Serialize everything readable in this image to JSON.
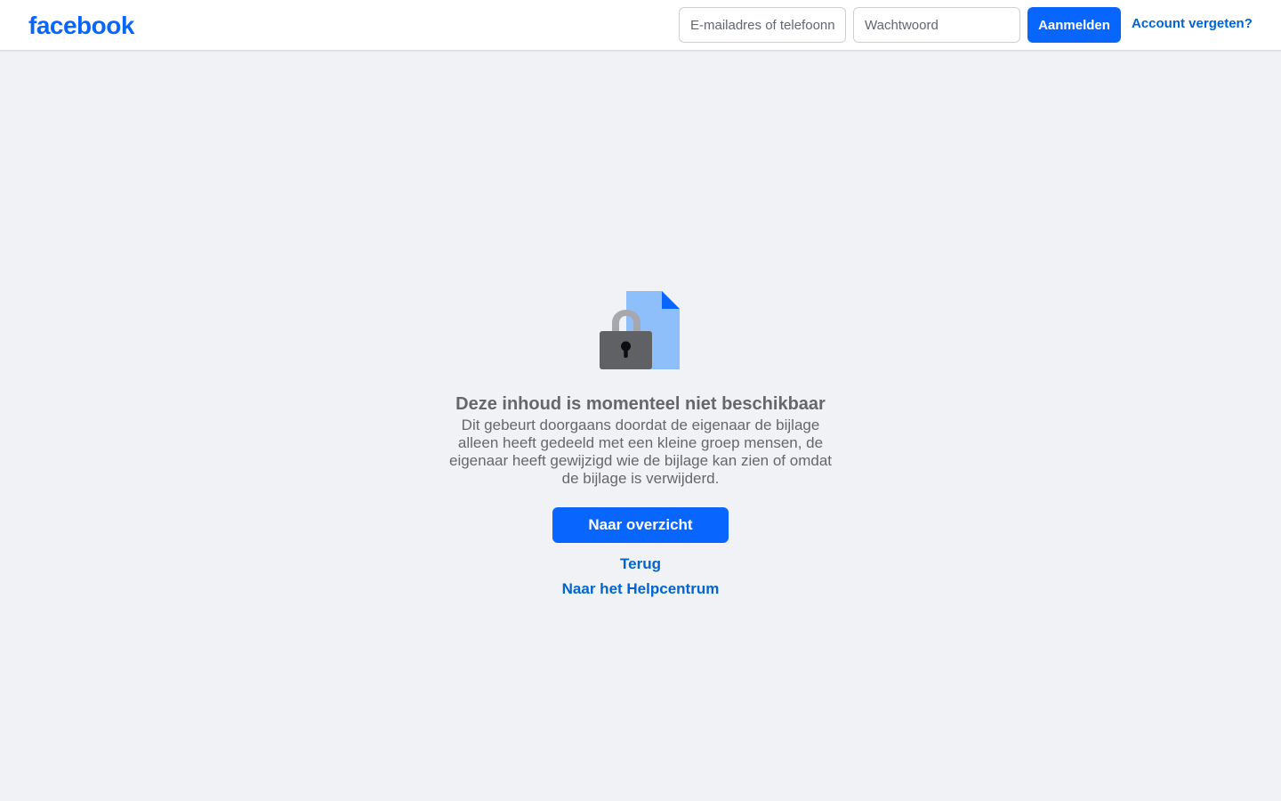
{
  "header": {
    "logo_text": "facebook",
    "email_placeholder": "E-mailadres of telefoonnummer",
    "password_placeholder": "Wachtwoord",
    "login_label": "Aanmelden",
    "forgot_label": "Account vergeten?"
  },
  "main": {
    "icon": "lock-document-icon",
    "headline": "Deze inhoud is momenteel niet beschikbaar",
    "description": "Dit gebeurt doorgaans doordat de eigenaar de bijlage alleen heeft gedeeld met een kleine groep mensen, de eigenaar heeft gewijzigd wie de bijlage kan zien of omdat de bijlage is verwijderd.",
    "primary_button": "Naar overzicht",
    "back_link": "Terug",
    "help_link": "Naar het Helpcentrum"
  },
  "colors": {
    "brand_blue": "#0866ff",
    "link_blue": "#0064d1",
    "background": "#f0f2f5",
    "text_secondary": "#65676b"
  }
}
